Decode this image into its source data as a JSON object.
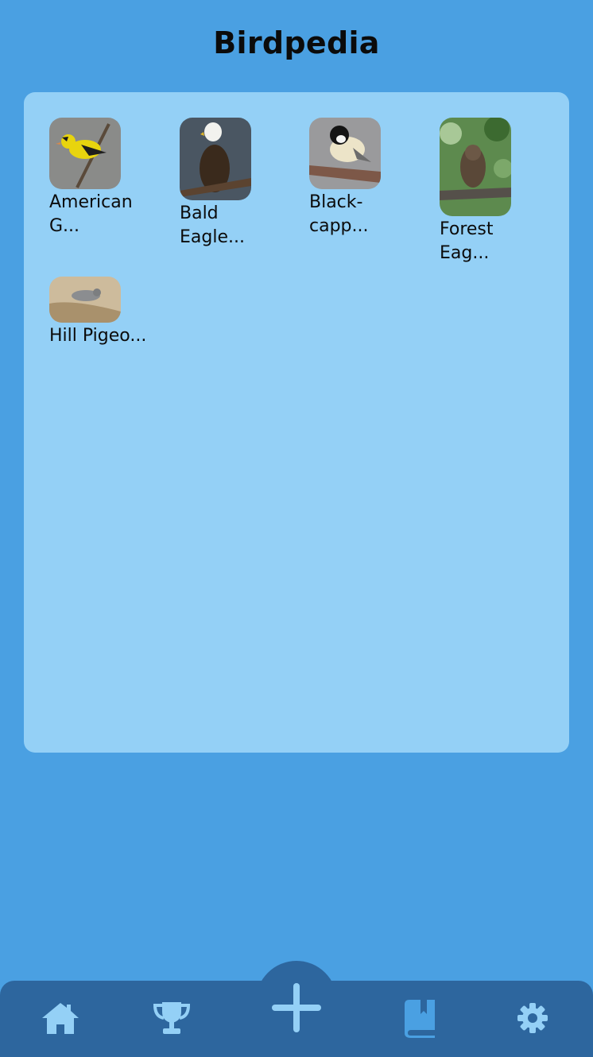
{
  "app": {
    "title": "Birdpedia"
  },
  "birds": [
    {
      "name": "American G...",
      "image": "american-goldfinch-photo"
    },
    {
      "name": "Bald Eagle...",
      "image": "bald-eagle-photo"
    },
    {
      "name": "Black-capp...",
      "image": "black-capped-chickadee-photo"
    },
    {
      "name": "Forest Eag...",
      "image": "forest-eagle-owl-photo"
    },
    {
      "name": "Hill Pigeo...",
      "image": "hill-pigeon-photo"
    }
  ],
  "nav": {
    "items": [
      {
        "icon": "home-icon"
      },
      {
        "icon": "trophy-icon"
      },
      {
        "icon": "add-icon"
      },
      {
        "icon": "book-icon",
        "active": true
      },
      {
        "icon": "gear-icon"
      }
    ]
  },
  "colors": {
    "background": "#4aa0e2",
    "panel": "#94d0f6",
    "navbar": "#2d669e",
    "nav_icon": "#94d0f6",
    "nav_icon_active": "#4aa0e2"
  }
}
